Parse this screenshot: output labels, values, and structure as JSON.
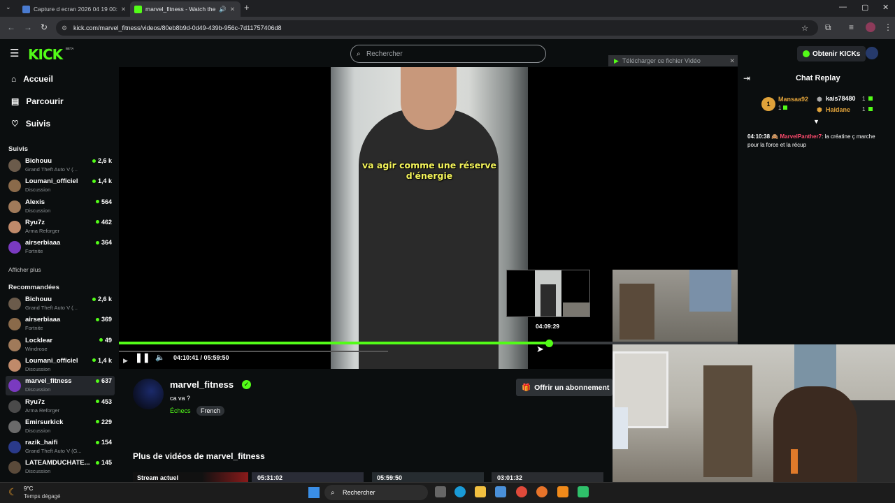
{
  "browser": {
    "tabs": [
      {
        "title": "Capture d ecran 2026 04 19 00:"
      },
      {
        "title": "marvel_fitness - Watch the"
      }
    ],
    "url": "kick.com/marvel_fitness/videos/80eb8b9d-0d49-439b-956c-7d11757406d8"
  },
  "header": {
    "logo": "KICK",
    "logo_badge": "BETA",
    "search_placeholder": "Rechercher",
    "kicks_button": "Obtenir KICKs"
  },
  "sidebar": {
    "nav": [
      {
        "label": "Accueil",
        "icon": "home-icon"
      },
      {
        "label": "Parcourir",
        "icon": "browse-icon"
      },
      {
        "label": "Suivis",
        "icon": "heart-icon"
      }
    ],
    "followed_title": "Suivis",
    "followed": [
      {
        "name": "Bichouu",
        "game": "Grand Theft Auto V (...",
        "viewers": "2,6 k"
      },
      {
        "name": "Loumani_officiel",
        "game": "Discussion",
        "viewers": "1,4 k"
      },
      {
        "name": "Alexis",
        "game": "Discussion",
        "viewers": "564"
      },
      {
        "name": "Ryu7z",
        "game": "Arma Reforger",
        "viewers": "462"
      },
      {
        "name": "airserbiaaa",
        "game": "Fortnite",
        "viewers": "364"
      }
    ],
    "show_more": "Afficher plus",
    "recommended_title": "Recommandées",
    "recommended": [
      {
        "name": "Bichouu",
        "game": "Grand Theft Auto V (...",
        "viewers": "2,6 k"
      },
      {
        "name": "airserbiaaa",
        "game": "Fortnite",
        "viewers": "369"
      },
      {
        "name": "Locklear",
        "game": "Windrose",
        "viewers": "49"
      },
      {
        "name": "Loumani_officiel",
        "game": "Discussion",
        "viewers": "1,4 k"
      },
      {
        "name": "marvel_fitness",
        "game": "Discussion",
        "viewers": "637"
      },
      {
        "name": "Ryu7z",
        "game": "Arma Reforger",
        "viewers": "453"
      },
      {
        "name": "Emirsurkick",
        "game": "Discussion",
        "viewers": "229"
      },
      {
        "name": "razik_haifi",
        "game": "Grand Theft Auto V (G...",
        "viewers": "154"
      },
      {
        "name": "LATEAMDUCHATE...",
        "game": "Discussion",
        "viewers": "145"
      }
    ]
  },
  "video": {
    "caption": "va agir comme une réserve d'énergie",
    "download_banner": "Télécharger ce fichier Vidéo",
    "preview_time": "04:09:29",
    "timecode": "04:10:41 / 05:59:50",
    "progress": 0.695
  },
  "chat": {
    "title": "Chat Replay",
    "leaderboard": [
      {
        "rank": "1",
        "name": "Mansaa92",
        "count": "1"
      },
      {
        "name": "kais78480",
        "count": "1"
      },
      {
        "name": "Haidane",
        "count": "1"
      }
    ],
    "messages": [
      {
        "time": "04:10:38",
        "user": "MarvelPanther7",
        "text": "la créatine ç marche pour la force et la récup"
      }
    ]
  },
  "channel": {
    "name": "marvel_fitness",
    "title": "ca va ?",
    "category": "Échecs",
    "tag": "French",
    "subscribe_button": "Offrir un abonnement",
    "more_videos_title": "Plus de vidéos de marvel_fitness",
    "cards": [
      {
        "label": "Stream actuel",
        "duration": "05:31:02"
      },
      {
        "label": "",
        "duration": "05:59:50"
      },
      {
        "label": "",
        "duration": "03:01:32"
      }
    ]
  },
  "taskbar": {
    "weather_temp": "9°C",
    "weather_desc": "Temps dégagé",
    "search": "Rechercher"
  },
  "colors": {
    "accent": "#53fc18",
    "bg": "#0b0e0f",
    "chat_user": "#ff4b6e"
  }
}
